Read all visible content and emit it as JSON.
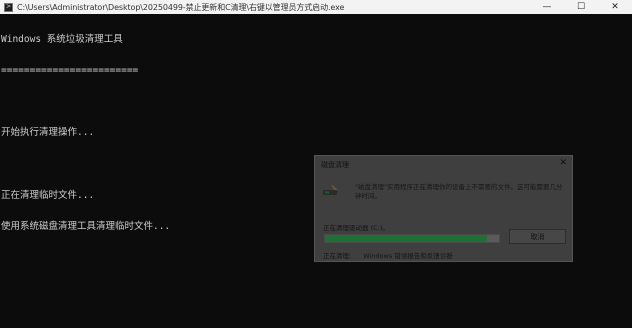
{
  "window": {
    "title": "C:\\Users\\Administrator\\Desktop\\20250499-禁止更新和C清理\\右键以管理员方式启动.exe",
    "controls": {
      "minimize": "—",
      "maximize": "☐",
      "close": "✕"
    }
  },
  "console": {
    "lines": [
      "Windows 系统垃圾清理工具",
      "========================",
      "",
      "开始执行清理操作...",
      "",
      "正在清理临时文件...",
      "使用系统磁盘清理工具清理临时文件..."
    ]
  },
  "dialog": {
    "title": "磁盘清理",
    "close_glyph": "✕",
    "message": "\"磁盘清理\"实用程序正在清理你的设备上不需要的文件。这可能需要几分钟时间。",
    "status": "正在清理驱动器 (C:)。",
    "progress": 0.93,
    "cancel_label": "取消",
    "footer_label": "正在清理:",
    "footer_value": "Windows 错误报告和反馈诊断"
  }
}
